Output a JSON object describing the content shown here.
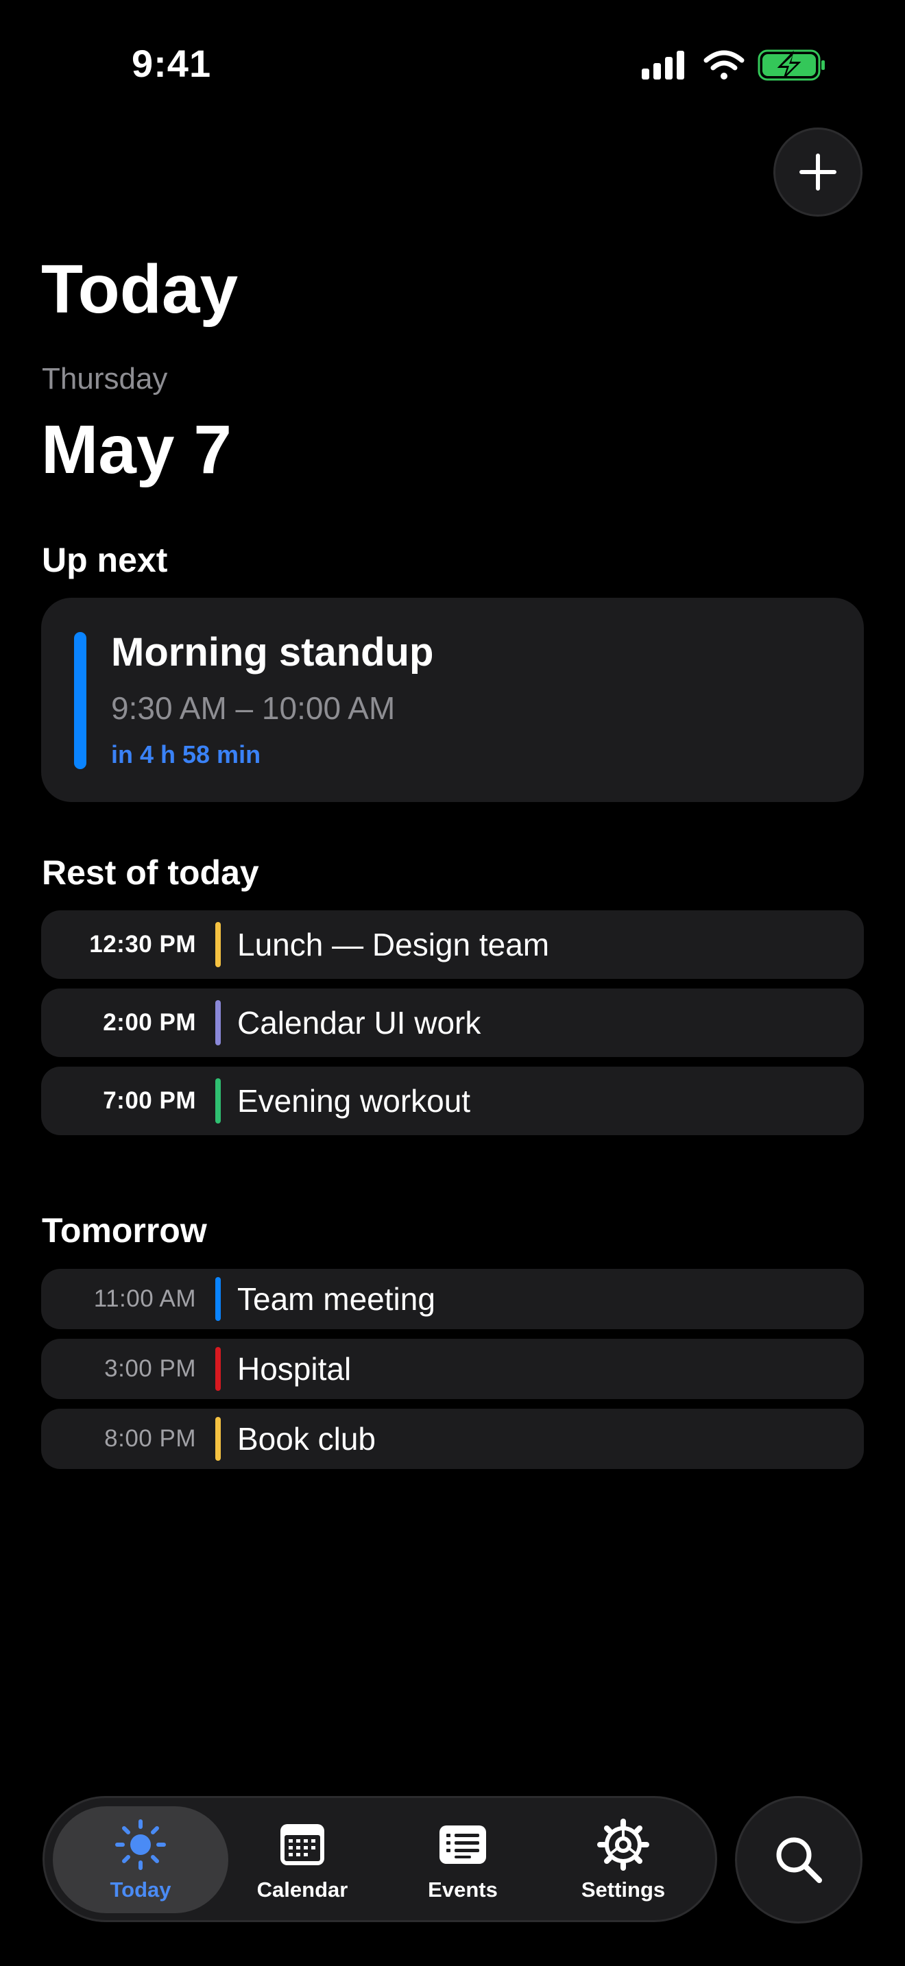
{
  "status_bar": {
    "time": "9:41",
    "icons": [
      "signal-icon",
      "wifi-icon",
      "battery-charging-icon"
    ],
    "battery_color": "#34c759"
  },
  "header": {
    "title": "Today",
    "weekday": "Thursday",
    "date": "May 7",
    "add_icon": "plus-icon"
  },
  "up_next": {
    "section_title": "Up next",
    "event": {
      "title": "Morning standup",
      "time_range": "9:30 AM – 10:00 AM",
      "countdown": "in 4 h 58 min",
      "color": "#0a84ff"
    }
  },
  "rest_of_today": {
    "section_title": "Rest of today",
    "events": [
      {
        "time": "12:30 PM",
        "title": "Lunch — Design team",
        "color": "#f5c242"
      },
      {
        "time": "2:00 PM",
        "title": "Calendar UI work",
        "color": "#8a88d8"
      },
      {
        "time": "7:00 PM",
        "title": "Evening workout",
        "color": "#2fbf71"
      }
    ]
  },
  "tomorrow": {
    "section_title": "Tomorrow",
    "events": [
      {
        "time": "11:00 AM",
        "title": "Team meeting",
        "color": "#0a84ff"
      },
      {
        "time": "3:00 PM",
        "title": "Hospital",
        "color": "#d71920"
      },
      {
        "time": "8:00 PM",
        "title": "Book club",
        "color": "#f5c242"
      }
    ]
  },
  "tab_bar": {
    "active": "Today",
    "active_color": "#4a8bf5",
    "tabs": [
      {
        "label": "Today",
        "icon": "sun-icon"
      },
      {
        "label": "Calendar",
        "icon": "calendar-icon"
      },
      {
        "label": "Events",
        "icon": "list-icon"
      },
      {
        "label": "Settings",
        "icon": "gear-icon"
      }
    ],
    "search_icon": "search-icon"
  }
}
